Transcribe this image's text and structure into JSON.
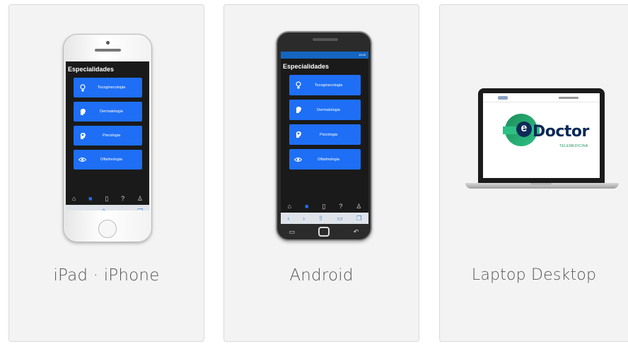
{
  "cards": {
    "ios": {
      "label": "iPad · iPhone",
      "screen_title": "Especialidades",
      "specialties": [
        {
          "label": "Tocoginecologia",
          "icon": "venus-icon"
        },
        {
          "label": "Dermatologia",
          "icon": "head-profile-icon"
        },
        {
          "label": "Psicologia",
          "icon": "brain-head-icon"
        },
        {
          "label": "Oftalmologia",
          "icon": "eye-icon"
        }
      ]
    },
    "android": {
      "label": "Android",
      "screen_title": "Especialidades",
      "status_time": "10:00",
      "specialties": [
        {
          "label": "Tocoginecologia",
          "icon": "venus-icon"
        },
        {
          "label": "Dermatologia",
          "icon": "head-profile-icon"
        },
        {
          "label": "Psicologia",
          "icon": "brain-head-icon"
        },
        {
          "label": "Oftalmologia",
          "icon": "eye-icon"
        }
      ]
    },
    "laptop": {
      "label": "Laptop Desktop",
      "brand_e": "e",
      "brand_word": "Doctor",
      "brand_sub": "TELEMEDICINA"
    }
  },
  "icons": {
    "tabbar": [
      "home-icon",
      "video-icon",
      "document-icon",
      "help-icon",
      "user-icon"
    ],
    "browserbar": [
      "back-icon",
      "forward-icon",
      "share-icon",
      "bookmarks-icon",
      "tabs-icon"
    ]
  },
  "colors": {
    "card_bg": "#f3f3f3",
    "button_blue": "#1e6ff5",
    "brand_green": "#2cc084",
    "brand_navy": "#0d2a57"
  }
}
